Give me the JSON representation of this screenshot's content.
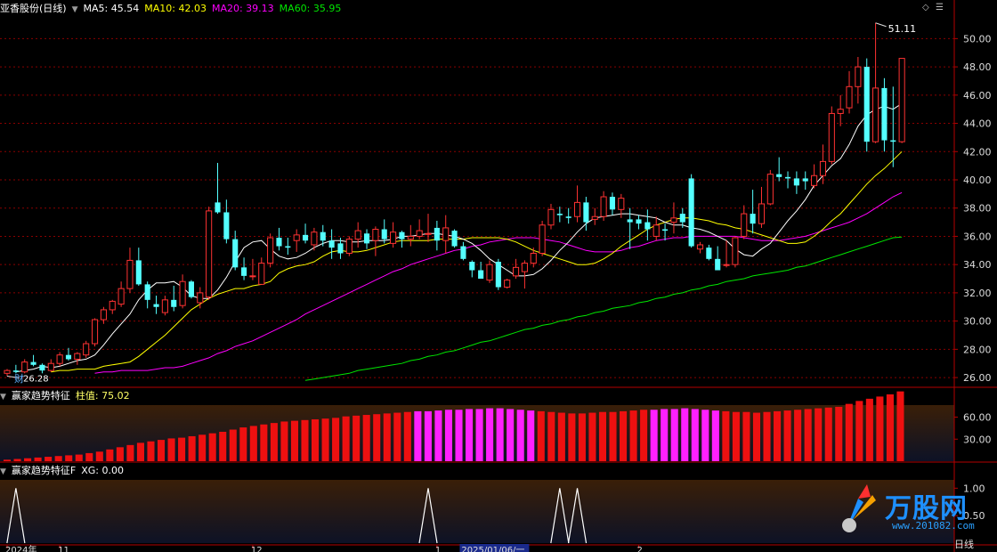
{
  "header": {
    "stock_name": "亚香股份(日线)",
    "ma5": "MA5: 45.54",
    "ma10": "MA10: 42.03",
    "ma20": "MA20: 39.13",
    "ma60": "MA60: 35.95"
  },
  "indicator1": {
    "name": "赢家趋势特征",
    "value_label": "柱值: 75.02"
  },
  "indicator2": {
    "name": "赢家趋势特征F",
    "value_label": "XG: 0.00"
  },
  "annotations": {
    "high_label": "51.11",
    "low_label": "26.28",
    "finance_mark": "财"
  },
  "xaxis": {
    "labels": [
      {
        "text": "2024年",
        "i": 0
      },
      {
        "text": "11",
        "i": 6
      },
      {
        "text": "12",
        "i": 28
      },
      {
        "text": "1",
        "i": 49
      },
      {
        "text": "2025/01/06/一",
        "i": 52
      },
      {
        "text": "2",
        "i": 72
      }
    ]
  },
  "status_right": "日线",
  "watermark": {
    "brand": "万股网",
    "url": "www.201082.com"
  },
  "colors": {
    "up": "#ff3232",
    "down": "#54ffff",
    "ma5": "#ffffff",
    "ma10": "#ffff00",
    "ma20": "#ff00ff",
    "ma60": "#00e600",
    "bar_red": "#ee1010",
    "bar_magenta": "#ff20ff",
    "axis": "#b40000",
    "grid": "#8a0000"
  },
  "chart_data": [
    {
      "type": "candlestick",
      "title": "亚香股份(日线)",
      "ylim": [
        25.5,
        51.6
      ],
      "yticks": [
        26.0,
        28.0,
        30.0,
        32.0,
        34.0,
        36.0,
        38.0,
        40.0,
        42.0,
        44.0,
        46.0,
        48.0,
        50.0
      ],
      "ohlc": [
        [
          26.3,
          26.6,
          26.1,
          26.5
        ],
        [
          26.5,
          26.9,
          26.3,
          26.4
        ],
        [
          26.4,
          27.3,
          26.3,
          27.1
        ],
        [
          27.1,
          27.6,
          26.8,
          26.9
        ],
        [
          26.9,
          27.0,
          26.3,
          26.5
        ],
        [
          26.5,
          27.3,
          26.4,
          27.0
        ],
        [
          27.0,
          27.8,
          26.8,
          27.6
        ],
        [
          27.6,
          28.1,
          27.2,
          27.3
        ],
        [
          27.3,
          27.8,
          26.9,
          27.7
        ],
        [
          27.6,
          28.6,
          27.4,
          28.4
        ],
        [
          28.4,
          30.2,
          28.2,
          30.1
        ],
        [
          30.1,
          31.0,
          29.8,
          30.8
        ],
        [
          30.8,
          31.5,
          30.5,
          31.4
        ],
        [
          31.2,
          32.8,
          31.0,
          32.3
        ],
        [
          32.3,
          35.2,
          32.0,
          34.3
        ],
        [
          34.3,
          35.2,
          32.5,
          32.6
        ],
        [
          32.6,
          32.8,
          30.9,
          31.5
        ],
        [
          31.2,
          31.8,
          30.5,
          31.0
        ],
        [
          30.6,
          31.8,
          30.4,
          31.5
        ],
        [
          31.5,
          32.5,
          30.7,
          31.0
        ],
        [
          31.1,
          33.3,
          30.9,
          32.8
        ],
        [
          32.8,
          32.9,
          31.6,
          31.7
        ],
        [
          31.3,
          32.4,
          30.9,
          32.0
        ],
        [
          31.7,
          38.1,
          31.5,
          37.8
        ],
        [
          38.4,
          41.2,
          37.6,
          37.7
        ],
        [
          37.7,
          38.6,
          35.5,
          35.8
        ],
        [
          35.8,
          36.4,
          33.6,
          33.8
        ],
        [
          33.8,
          34.5,
          32.9,
          33.2
        ],
        [
          33.2,
          34.4,
          32.9,
          33.2
        ],
        [
          32.6,
          34.5,
          32.6,
          34.1
        ],
        [
          34.1,
          36.2,
          33.8,
          35.9
        ],
        [
          35.9,
          36.6,
          35.0,
          35.3
        ],
        [
          35.3,
          35.9,
          34.7,
          35.2
        ],
        [
          35.7,
          36.5,
          34.9,
          36.1
        ],
        [
          36.1,
          36.9,
          35.5,
          35.7
        ],
        [
          35.4,
          36.6,
          35.0,
          36.3
        ],
        [
          36.3,
          36.8,
          35.3,
          35.7
        ],
        [
          35.7,
          36.5,
          34.4,
          35.2
        ],
        [
          35.5,
          35.9,
          34.4,
          34.8
        ],
        [
          34.8,
          36.0,
          34.6,
          35.8
        ],
        [
          35.8,
          37.0,
          35.2,
          36.4
        ],
        [
          36.2,
          36.5,
          35.1,
          35.5
        ],
        [
          35.7,
          36.7,
          34.6,
          36.5
        ],
        [
          36.5,
          37.2,
          35.5,
          35.8
        ],
        [
          35.5,
          37.0,
          35.2,
          36.3
        ],
        [
          36.3,
          36.4,
          35.2,
          35.8
        ],
        [
          35.8,
          36.8,
          35.3,
          36.0
        ],
        [
          36.0,
          37.2,
          35.8,
          36.4
        ],
        [
          36.2,
          37.6,
          35.6,
          36.2
        ],
        [
          36.6,
          37.1,
          35.0,
          35.7
        ],
        [
          35.7,
          37.5,
          34.8,
          36.6
        ],
        [
          36.4,
          36.5,
          35.2,
          35.3
        ],
        [
          35.3,
          35.6,
          34.3,
          34.4
        ],
        [
          34.2,
          34.3,
          33.1,
          33.6
        ],
        [
          33.6,
          34.2,
          33.1,
          33.0
        ],
        [
          32.9,
          34.3,
          32.7,
          34.0
        ],
        [
          34.2,
          34.4,
          32.2,
          32.4
        ],
        [
          32.4,
          33.0,
          32.3,
          32.9
        ],
        [
          33.2,
          34.4,
          33.0,
          33.8
        ],
        [
          33.5,
          34.3,
          32.3,
          34.1
        ],
        [
          34.1,
          35.2,
          33.8,
          34.8
        ],
        [
          34.8,
          37.1,
          34.6,
          36.8
        ],
        [
          36.8,
          38.3,
          36.5,
          37.9
        ],
        [
          37.6,
          38.1,
          37.0,
          37.5
        ],
        [
          37.4,
          38.0,
          36.9,
          37.3
        ],
        [
          37.4,
          39.6,
          37.0,
          38.4
        ],
        [
          38.4,
          38.8,
          36.4,
          37.0
        ],
        [
          37.2,
          38.0,
          36.8,
          37.4
        ],
        [
          37.4,
          39.2,
          37.1,
          38.8
        ],
        [
          38.8,
          39.1,
          37.5,
          37.9
        ],
        [
          37.9,
          39.0,
          37.3,
          38.7
        ],
        [
          37.2,
          38.0,
          35.1,
          37.0
        ],
        [
          37.2,
          37.5,
          36.5,
          36.9
        ],
        [
          37.0,
          37.9,
          35.7,
          36.5
        ],
        [
          36.0,
          37.4,
          35.7,
          36.8
        ],
        [
          36.5,
          36.9,
          35.7,
          36.4
        ],
        [
          37.0,
          38.4,
          36.2,
          37.3
        ],
        [
          37.6,
          38.0,
          36.6,
          37.0
        ],
        [
          40.1,
          40.4,
          35.2,
          35.3
        ],
        [
          35.1,
          35.6,
          34.8,
          35.4
        ],
        [
          35.2,
          35.4,
          34.3,
          34.4
        ],
        [
          34.4,
          35.3,
          33.8,
          33.6
        ],
        [
          34.0,
          35.7,
          33.8,
          34.0
        ],
        [
          34.0,
          36.0,
          33.8,
          35.9
        ],
        [
          36.0,
          38.2,
          35.8,
          37.6
        ],
        [
          37.6,
          39.3,
          36.2,
          36.9
        ],
        [
          36.9,
          39.5,
          36.6,
          38.3
        ],
        [
          38.3,
          40.7,
          38.2,
          40.4
        ],
        [
          40.4,
          41.6,
          39.9,
          40.2
        ],
        [
          40.2,
          40.6,
          39.4,
          40.1
        ],
        [
          40.1,
          40.6,
          39.0,
          39.6
        ],
        [
          40.1,
          40.6,
          39.3,
          39.9
        ],
        [
          39.6,
          41.1,
          39.4,
          40.3
        ],
        [
          40.3,
          42.5,
          39.7,
          41.3
        ],
        [
          41.3,
          45.2,
          41.1,
          44.7
        ],
        [
          44.7,
          46.0,
          43.8,
          45.0
        ],
        [
          45.1,
          47.7,
          44.7,
          46.6
        ],
        [
          46.6,
          48.7,
          45.4,
          48.0
        ],
        [
          48.0,
          48.6,
          42.0,
          42.7
        ],
        [
          42.7,
          51.11,
          42.6,
          46.5
        ],
        [
          46.5,
          47.2,
          42.0,
          42.8
        ],
        [
          42.8,
          46.6,
          40.9,
          42.7
        ],
        [
          42.7,
          48.6,
          42.6,
          48.6
        ]
      ],
      "ma5": [
        26.4,
        26.5,
        26.6,
        26.8,
        26.7,
        26.8,
        27.0,
        27.2,
        27.3,
        27.6,
        28.3,
        29.1,
        29.8,
        30.5,
        31.5,
        32.2,
        32.7,
        32.7,
        32.8,
        32.4,
        31.8,
        31.6,
        31.6,
        32.2,
        33.1,
        34.2,
        35.2,
        35.6,
        35.7,
        35.1,
        34.6,
        34.4,
        34.5,
        34.8,
        35.2,
        35.5,
        35.7,
        35.7,
        35.6,
        35.6,
        35.7,
        35.7,
        35.7,
        35.8,
        36.0,
        36.0,
        36.1,
        36.2,
        36.2,
        36.1,
        36.0,
        35.8,
        35.5,
        35.0,
        34.4,
        34.0,
        33.6,
        33.2,
        33.2,
        33.3,
        33.7,
        34.3,
        35.0,
        35.6,
        36.3,
        36.9,
        37.3,
        37.4,
        37.5,
        37.6,
        37.6,
        37.5,
        37.4,
        37.3,
        37.0,
        36.8,
        36.8,
        36.6,
        36.5,
        36.3,
        36.0,
        35.7,
        35.1,
        34.7,
        34.6,
        35.1,
        35.5,
        36.3,
        37.1,
        37.8,
        38.6,
        39.6,
        40.3,
        41.0,
        41.5,
        42.5,
        43.8,
        44.6,
        45.0,
        45.2,
        45.0,
        45.4
      ],
      "ma10": [
        26.4,
        26.5,
        26.5,
        26.6,
        26.6,
        26.6,
        26.8,
        26.9,
        27.0,
        27.1,
        27.5,
        28.0,
        28.5,
        29.0,
        29.6,
        30.2,
        30.8,
        31.2,
        31.6,
        31.9,
        32.1,
        32.3,
        32.3,
        32.5,
        32.6,
        32.8,
        33.4,
        33.7,
        33.9,
        34.0,
        34.2,
        34.6,
        34.9,
        35.0,
        34.9,
        34.9,
        35.0,
        35.2,
        35.4,
        35.6,
        35.7,
        35.7,
        35.7,
        35.7,
        35.8,
        35.8,
        35.8,
        35.8,
        35.9,
        35.9,
        35.9,
        35.9,
        35.8,
        35.6,
        35.3,
        35.0,
        34.8,
        34.6,
        34.4,
        34.2,
        34.0,
        34.0,
        34.1,
        34.4,
        34.8,
        35.3,
        35.7,
        36.1,
        36.5,
        36.8,
        37.0,
        37.2,
        37.3,
        37.3,
        37.2,
        37.1,
        36.9,
        36.8,
        36.6,
        36.5,
        36.3,
        36.1,
        35.9,
        35.7,
        35.5,
        35.5,
        35.6,
        36.0,
        36.5,
        37.1,
        37.6,
        38.3,
        39.0,
        39.7,
        40.3,
        40.8,
        41.4,
        42.0
      ],
      "ma20": [
        26.3,
        26.4,
        26.4,
        26.5,
        26.5,
        26.5,
        26.5,
        26.6,
        26.7,
        26.7,
        26.8,
        27.0,
        27.2,
        27.4,
        27.7,
        27.9,
        28.2,
        28.4,
        28.6,
        28.9,
        29.2,
        29.5,
        29.8,
        30.1,
        30.5,
        30.8,
        31.1,
        31.4,
        31.7,
        32.0,
        32.3,
        32.6,
        32.9,
        33.2,
        33.5,
        33.7,
        34.0,
        34.2,
        34.4,
        34.6,
        34.8,
        35.0,
        35.1,
        35.3,
        35.4,
        35.6,
        35.7,
        35.8,
        35.9,
        35.9,
        35.9,
        35.8,
        35.7,
        35.6,
        35.4,
        35.2,
        35.0,
        34.9,
        34.9,
        34.9,
        35.0,
        35.2,
        35.3,
        35.5,
        35.7,
        35.8,
        35.9,
        35.9,
        36.0,
        36.0,
        36.0,
        36.0,
        36.0,
        36.0,
        35.9,
        35.8,
        35.7,
        35.7,
        35.7,
        35.8,
        35.9,
        36.0,
        36.2,
        36.4,
        36.6,
        36.8,
        37.0,
        37.3,
        37.6,
        38.0,
        38.4,
        38.8,
        39.1
      ],
      "ma60": [
        25.8,
        25.9,
        26.0,
        26.1,
        26.2,
        26.3,
        26.5,
        26.6,
        26.7,
        26.8,
        26.9,
        27.0,
        27.2,
        27.3,
        27.5,
        27.6,
        27.8,
        27.9,
        28.1,
        28.3,
        28.5,
        28.6,
        28.8,
        29.0,
        29.2,
        29.4,
        29.5,
        29.7,
        29.8,
        30.0,
        30.1,
        30.3,
        30.4,
        30.6,
        30.7,
        30.9,
        31.0,
        31.1,
        31.3,
        31.4,
        31.6,
        31.7,
        31.9,
        32.0,
        32.2,
        32.3,
        32.5,
        32.6,
        32.8,
        32.9,
        33.0,
        33.2,
        33.3,
        33.4,
        33.5,
        33.6,
        33.8,
        33.9,
        34.1,
        34.3,
        34.5,
        34.7,
        34.9,
        35.1,
        35.3,
        35.5,
        35.7,
        35.9,
        35.95
      ]
    },
    {
      "type": "bar",
      "title": "赢家趋势特征",
      "ylim": [
        0,
        80
      ],
      "yticks": [
        30.0,
        60.0
      ],
      "values": [
        2,
        3,
        4,
        5,
        6,
        7,
        8,
        9,
        11,
        13,
        16,
        19,
        22,
        25,
        27,
        29,
        31,
        32,
        34,
        36,
        38,
        40,
        43,
        46,
        48,
        50,
        52,
        54,
        55,
        56,
        57,
        58,
        59,
        61,
        62,
        63,
        64,
        65,
        66,
        67,
        68,
        68,
        69,
        70,
        70,
        71,
        71,
        72,
        72,
        71,
        70,
        69,
        68,
        67,
        66,
        65,
        65,
        66,
        67,
        67,
        68,
        69,
        70,
        70,
        71,
        71,
        72,
        71,
        70,
        69,
        68,
        67,
        67,
        66,
        67,
        68,
        69,
        70,
        71,
        72,
        73,
        74,
        78,
        82,
        85,
        88,
        91,
        95
      ],
      "magenta_from": 40,
      "magenta_to": 51,
      "magenta2_from": 63,
      "magenta2_to": 69
    },
    {
      "type": "line",
      "title": "赢家趋势特征F",
      "ylim": [
        0,
        1.2
      ],
      "yticks": [
        0.5,
        1.0
      ],
      "spikes": [
        1,
        48,
        63,
        65
      ]
    }
  ]
}
